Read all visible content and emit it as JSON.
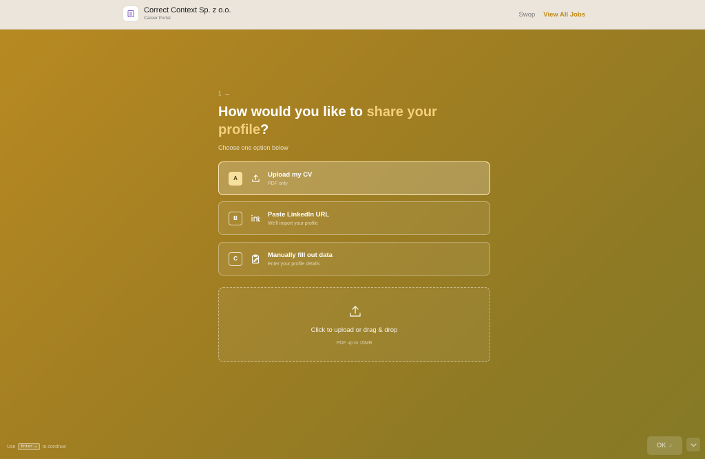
{
  "header": {
    "company_name": "Correct Context Sp. z o.o.",
    "portal_label": "Career Portal",
    "nav": {
      "swop": "Swop",
      "view_all_jobs": "View All Jobs"
    },
    "logo_icon": "building-icon"
  },
  "form": {
    "step": "1 →",
    "question_prefix": "How would you like to",
    "question_highlight": "share your profile",
    "question_suffix": "?",
    "hint": "Choose one option below",
    "highlight_color": "#f3d07c",
    "options": [
      {
        "key": "A",
        "title": "Upload my CV",
        "subtitle": "PDF only",
        "icon": "upload-icon",
        "selected": true
      },
      {
        "key": "B",
        "title": "Paste LinkedIn URL",
        "subtitle": "We'll import your profile",
        "icon": "linkedin-icon",
        "selected": false
      },
      {
        "key": "C",
        "title": "Manually fill out data",
        "subtitle": "Enter your profile details",
        "icon": "clipboard-icon",
        "selected": false
      }
    ],
    "dropzone": {
      "main": "Click to upload or drag & drop",
      "sub": "PDF up to 10MB",
      "icon": "upload-icon"
    }
  },
  "footer": {
    "hint_prefix": "Use",
    "hint_key": "Enter ↵",
    "hint_suffix": "to continue",
    "ok_label": "OK",
    "ok_check": "✓"
  }
}
